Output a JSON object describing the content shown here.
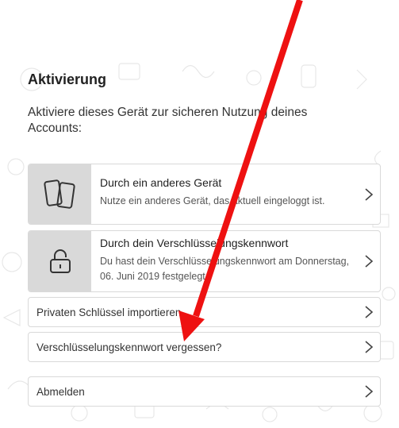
{
  "activation": {
    "title": "Aktivierung",
    "description": "Aktiviere dieses Gerät zur sicheren Nutzung deines Accounts:"
  },
  "options": [
    {
      "title": "Durch ein anderes Gerät",
      "subtitle": "Nutze ein anderes Gerät, das aktuell eingeloggt ist.",
      "icon": "devices-icon"
    },
    {
      "title": "Durch dein Verschlüsselungskennwort",
      "subtitle": "Du hast dein Verschlüsselungskennwort am Donnerstag, 06. Juni 2019 festgelegt.",
      "icon": "lock-icon"
    }
  ],
  "actions": {
    "import_key": "Privaten Schlüssel importieren",
    "forgot_password": "Verschlüsselungskennwort vergessen?",
    "logout": "Abmelden"
  },
  "colors": {
    "annotation_arrow": "#ee1111",
    "icon_box": "#d9d9d9"
  }
}
